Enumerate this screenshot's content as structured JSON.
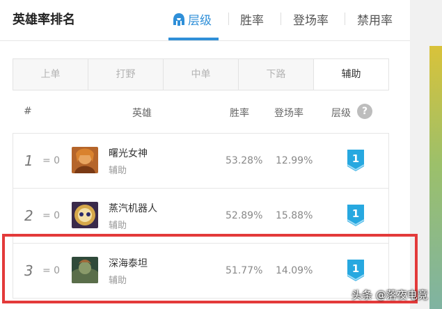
{
  "header": {
    "title": "英雄率排名",
    "tabs": [
      {
        "label": "层级",
        "active": true,
        "icon": "helmet-icon"
      },
      {
        "label": "胜率",
        "active": false
      },
      {
        "label": "登场率",
        "active": false
      },
      {
        "label": "禁用率",
        "active": false
      }
    ]
  },
  "lanes": [
    {
      "label": "上单",
      "active": false
    },
    {
      "label": "打野",
      "active": false
    },
    {
      "label": "中单",
      "active": false
    },
    {
      "label": "下路",
      "active": false
    },
    {
      "label": "辅助",
      "active": true
    }
  ],
  "columns": {
    "rank": "#",
    "hero": "英雄",
    "winrate": "胜率",
    "pickrate": "登场率",
    "tier": "层级",
    "help": "?"
  },
  "rows": [
    {
      "rank": "1",
      "change": "= 0",
      "name": "曙光女神",
      "role": "辅助",
      "winrate": "53.28%",
      "pickrate": "12.99%",
      "tier": "1"
    },
    {
      "rank": "2",
      "change": "= 0",
      "name": "蒸汽机器人",
      "role": "辅助",
      "winrate": "52.89%",
      "pickrate": "15.88%",
      "tier": "1"
    },
    {
      "rank": "3",
      "change": "= 0",
      "name": "深海泰坦",
      "role": "辅助",
      "winrate": "51.77%",
      "pickrate": "14.09%",
      "tier": "1"
    }
  ],
  "watermark": "头条 @落夜电竞",
  "colors": {
    "accent": "#2f8fd8",
    "tier_badge": "#27a8e0",
    "highlight": "#e33a3a"
  }
}
